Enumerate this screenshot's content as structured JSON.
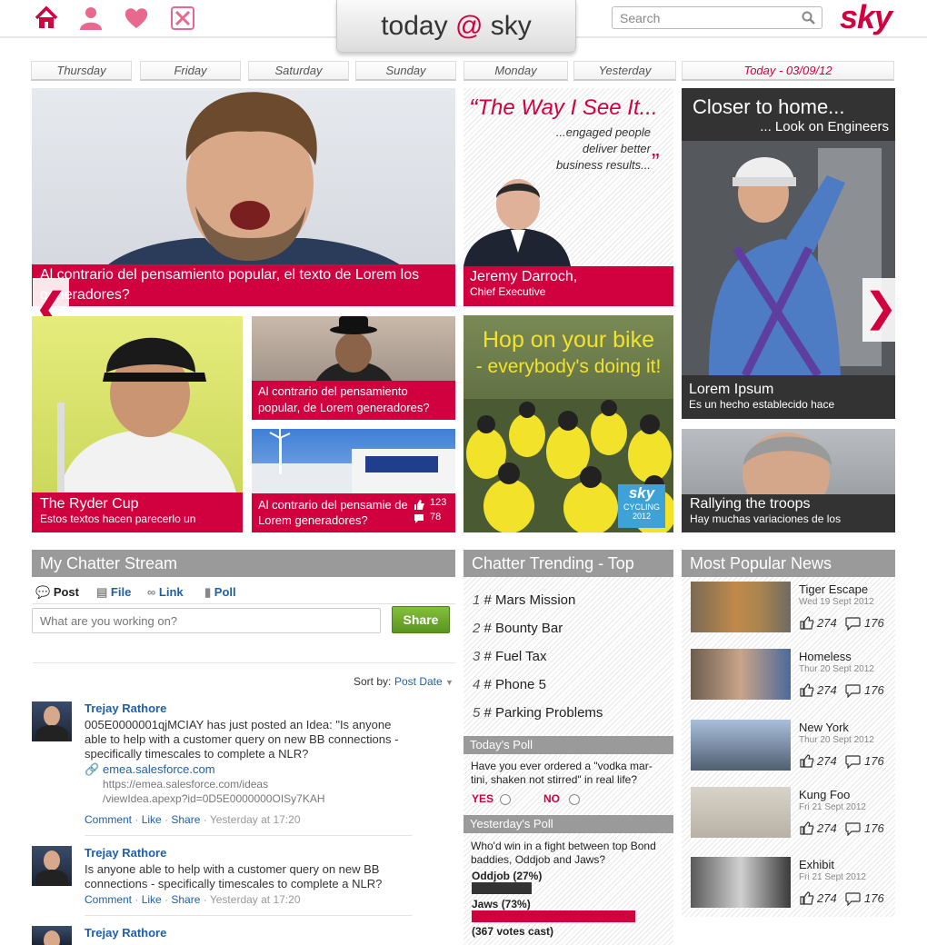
{
  "header": {
    "brand": {
      "left": "today ",
      "at": "@",
      "right": " sky"
    },
    "search_placeholder": "Search",
    "logo_text": "sky",
    "nav_icons": [
      "home-icon",
      "profile-icon",
      "heart-icon",
      "tools-icon"
    ]
  },
  "days": [
    "Thursday",
    "Friday",
    "Saturday",
    "Sunday",
    "Monday",
    "Yesterday",
    "Today - 03/09/12"
  ],
  "tiles": {
    "main": {
      "text": "Al contrario del pensamiento popular, el texto de Lorem los generadores?"
    },
    "quote": {
      "title": "The Way I See It...",
      "quote": "...engaged people deliver better business results...",
      "name": "Jeremy Darroch,",
      "role": "Chief Executive"
    },
    "engineers": {
      "title": "Closer to home...",
      "subtitle": "... Look on Engineers",
      "caption": "Lorem Ipsum",
      "caption_sub": "Es un hecho establecido hace"
    },
    "golf": {
      "title": "The Ryder Cup",
      "sub": "Estos textos hacen parecerlo un"
    },
    "bond": {
      "text": "Al contrario del pensamiento popular, de Lorem  generadores?"
    },
    "building": {
      "text": "Al contrario del pensamie de Lorem  generadores?",
      "likes": "123",
      "comments": "78"
    },
    "bike": {
      "line1": "Hop on your bike",
      "line2": "- everybody's doing it!",
      "badge": "sky",
      "badge_sub": "CYCLING",
      "badge_year": "2012"
    },
    "rally": {
      "title": "Rallying the troops",
      "sub": "Hay muchas variaciones de los"
    }
  },
  "chatter": {
    "title": "My Chatter Stream",
    "tabs": [
      {
        "label": "Post"
      },
      {
        "label": "File"
      },
      {
        "label": "Link"
      },
      {
        "label": "Poll"
      }
    ],
    "input_placeholder": "What are you working on?",
    "share": "Share",
    "sort_label": "Sort by:",
    "sort_value": "Post Date",
    "posts": [
      {
        "author": "Trejay Rathore",
        "text": "005E0000001qjMCIAY has just posted an Idea: \"Is anyone able to help with a customer query on new BB connections - specifically timescales to complete a NLR?",
        "link": "emea.salesforce.com",
        "url1": "https://emea.salesforce.com/ideas",
        "url2": "/viewIdea.apexp?id=0D5E0000000OISy7KAH",
        "time": "Yesterday at 17:20"
      },
      {
        "author": "Trejay Rathore",
        "text": "Is anyone able to help with a customer query on new BB connections - specifically timescales to complete a NLR?",
        "time": "Yesterday at 17:20"
      },
      {
        "author": "Trejay Rathore"
      }
    ],
    "actions": {
      "comment": "Comment",
      "like": "Like",
      "share": "Share"
    }
  },
  "trending": {
    "title": "Chatter Trending - Top",
    "items": [
      {
        "n": "1",
        "tag": "# Mars Mission"
      },
      {
        "n": "2",
        "tag": "# Bounty Bar"
      },
      {
        "n": "3",
        "tag": "# Fuel Tax"
      },
      {
        "n": "4",
        "tag": "# Phone 5"
      },
      {
        "n": "5",
        "tag": "# Parking Problems"
      }
    ]
  },
  "poll_today": {
    "title": "Today's Poll",
    "question": "Have you ever ordered a \"vodka mar-tini, shaken not stirred\" in real life?",
    "yes": "YES",
    "no": "NO"
  },
  "poll_yesterday": {
    "title": "Yesterday's Poll",
    "question": "Who'd win in a fight between top Bond baddies, Oddjob and Jaws?",
    "options": [
      {
        "label": "Oddjob (27%)",
        "value": 27
      },
      {
        "label": "Jaws (73%)",
        "value": 73
      }
    ],
    "total": "(367 votes cast)"
  },
  "popular": {
    "title": "Most Popular News",
    "items": [
      {
        "title": "Tiger Escape",
        "date": "Wed 19 Sept 2012",
        "likes": "274",
        "comments": "176"
      },
      {
        "title": "Homeless",
        "date": "Thur 20 Sept 2012",
        "likes": "274",
        "comments": "176"
      },
      {
        "title": "New York",
        "date": "Thur 20 Sept 2012",
        "likes": "274",
        "comments": "176"
      },
      {
        "title": "Kung Foo",
        "date": "Fri 21 Sept 2012",
        "likes": "274",
        "comments": "176"
      },
      {
        "title": "Exhibit",
        "date": "Fri 21 Sept 2012",
        "likes": "274",
        "comments": "176"
      }
    ]
  },
  "colors": {
    "accent": "#d1003f",
    "section_grey": "#9a9a9a",
    "link_blue": "#1f5fa8",
    "share_green": "#6aa528"
  }
}
